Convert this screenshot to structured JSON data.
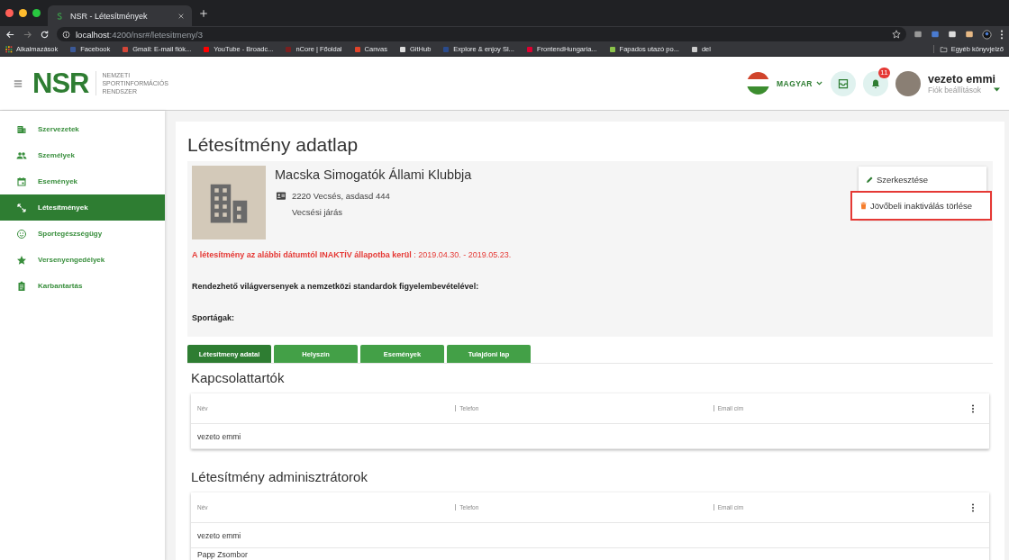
{
  "browser": {
    "tab_title": "NSR - Létesítmények",
    "url": "**localhost**:4200/nsr#/letesitmeny/3",
    "bookmarks": [
      "Alkalmazások",
      "Facebook",
      "Gmail: E-mail fiók...",
      "YouTube - Broadc...",
      "nCore | Főoldal",
      "Canvas",
      "GitHub",
      "Explore & enjoy Sl...",
      "FrontendHungaria...",
      "Fapados utazó po...",
      "del"
    ],
    "other_bookmarks": "Egyéb könyvjelző"
  },
  "header": {
    "logo": "NSR",
    "logo_subtitle": [
      "NEMZETI",
      "SPORTINFORMÁCIÓS",
      "RENDSZER"
    ],
    "language": "MAGYAR",
    "notification_count": "11",
    "user_name": "vezeto emmi",
    "account_link": "Fiók beállítások"
  },
  "sidebar": {
    "items": [
      {
        "label": "Szervezetek",
        "selected": false
      },
      {
        "label": "Személyek",
        "selected": false
      },
      {
        "label": "Események",
        "selected": false
      },
      {
        "label": "Létesítmények",
        "selected": true
      },
      {
        "label": "Sportegészségügy",
        "selected": false
      },
      {
        "label": "Versenyengedélyek",
        "selected": false
      },
      {
        "label": "Karbantartás",
        "selected": false
      }
    ]
  },
  "page_title": "Létesítmény adatlap",
  "facility": {
    "name": "Macska Simogatók Állami Klubbja",
    "address": "2220 Vecsés, asdasd 444",
    "district": "Vecsési járás",
    "warning": "**A létesítmény az alábbi dátumtól INAKTÍV állapotba kerül** : 2019.04.30. - 2019.05.23.",
    "fields": [
      "Rendezhető világversenyek a nemzetközi standardok figyelembevételével:",
      "Sportágak:"
    ],
    "actions": [
      {
        "kind": "edit",
        "label": "Szerkesztése",
        "highlighted": false
      },
      {
        "kind": "delete",
        "label": "Jövőbeli inaktiválás törlése",
        "highlighted": true
      }
    ]
  },
  "tabs": [
    {
      "label": "Létesítmeny adatai",
      "selected": true
    },
    {
      "label": "Helyszín",
      "selected": false
    },
    {
      "label": "Események",
      "selected": false
    },
    {
      "label": "Tulajdoni lap",
      "selected": false
    }
  ],
  "sections": [
    {
      "title": "Kapcsolattartók",
      "columns": [
        "Név",
        "Telefon",
        "Email cím"
      ],
      "rows": [
        [
          "vezeto emmi"
        ]
      ]
    },
    {
      "title": "Létesítmény adminisztrátorok",
      "columns": [
        "Név",
        "Telefon",
        "Email cím"
      ],
      "rows": [
        [
          "vezeto emmi"
        ],
        [
          "Papp Zsombor"
        ]
      ]
    }
  ]
}
